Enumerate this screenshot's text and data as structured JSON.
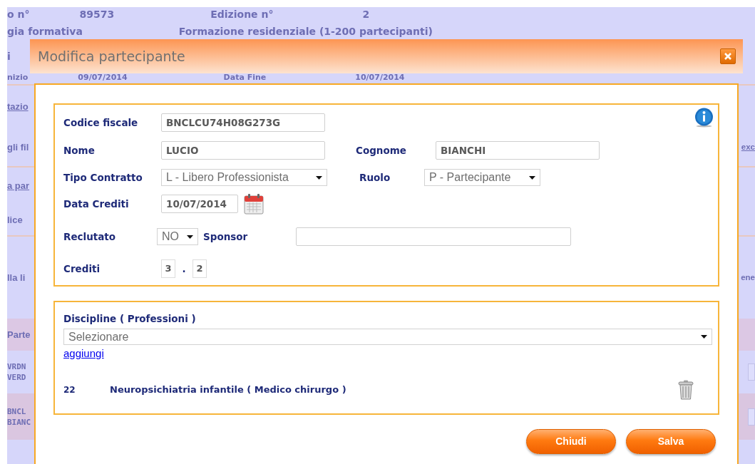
{
  "background_page": {
    "rows": [
      {
        "kind": "fields",
        "items": [
          "o n°",
          "89573",
          "Edizione n°",
          "2"
        ]
      },
      {
        "kind": "fields",
        "items": [
          "gia formativa",
          "Formazione residenziale (1-200 partecipanti)"
        ]
      },
      {
        "kind": "fields",
        "items": [
          "i"
        ]
      },
      {
        "kind": "fields",
        "items": [
          "nizio",
          "09/07/2014",
          "Data Fine",
          "10/07/2014"
        ]
      },
      {
        "kind": "link",
        "left": "tazio"
      },
      {
        "kind": "text",
        "left": "gli fil",
        "right_link": "exc"
      },
      {
        "kind": "link",
        "left": "a par"
      },
      {
        "kind": "text",
        "left": "lice"
      },
      {
        "kind": "text",
        "left": "lla li",
        "right": "ene"
      },
      {
        "kind": "table_header",
        "left": "Parte"
      },
      {
        "kind": "table_row",
        "lines": [
          "VRDN",
          "VERD"
        ]
      },
      {
        "kind": "table_row",
        "lines": [
          "BNCL",
          "BIANC"
        ]
      }
    ]
  },
  "dialog": {
    "title": "Modifica partecipante",
    "form": {
      "codice_fiscale": {
        "label": "Codice fiscale",
        "value": "BNCLCU74H08G273G"
      },
      "nome": {
        "label": "Nome",
        "value": "LUCIO"
      },
      "cognome": {
        "label": "Cognome",
        "value": "BIANCHI"
      },
      "tipo_contratto": {
        "label": "Tipo Contratto",
        "value": "L - Libero Professionista"
      },
      "ruolo": {
        "label": "Ruolo",
        "value": "P - Partecipante"
      },
      "data_crediti": {
        "label": "Data Crediti",
        "value": "10/07/2014"
      },
      "reclutato": {
        "label": "Reclutato",
        "value": "NO"
      },
      "sponsor": {
        "label": "Sponsor"
      },
      "crediti": {
        "label": "Crediti",
        "integer": "3",
        "separator": ".",
        "decimal": "2"
      }
    },
    "discipline": {
      "title": "Discipline ( Professioni )",
      "select": {
        "value": "Selezionare"
      },
      "add_link": "aggiungi",
      "items": [
        {
          "code": "22",
          "name": "Neuropsichiatria infantile ( Medico chirurgo )"
        }
      ]
    },
    "buttons": [
      "Chiudi",
      "Salva"
    ]
  }
}
